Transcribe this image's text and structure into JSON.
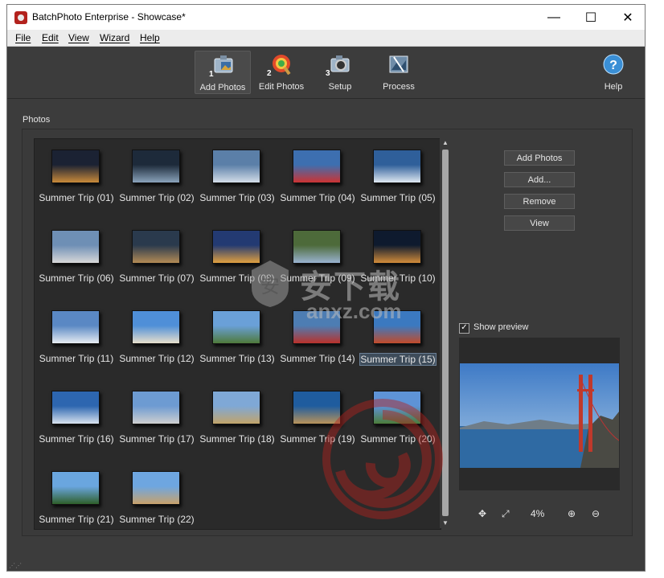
{
  "window": {
    "title": "BatchPhoto Enterprise - Showcase*",
    "minimize": "—",
    "maximize": "☐",
    "close": "✕"
  },
  "menu": [
    "File",
    "Edit",
    "View",
    "Wizard",
    "Help"
  ],
  "toolbar": {
    "steps": [
      {
        "num": "1",
        "label": "Add Photos"
      },
      {
        "num": "2",
        "label": "Edit Photos"
      },
      {
        "num": "3",
        "label": "Setup"
      },
      {
        "num": "",
        "label": "Process"
      }
    ],
    "help": "Help"
  },
  "photos": {
    "section_label": "Photos",
    "items": [
      "Summer Trip (01)",
      "Summer Trip (02)",
      "Summer Trip (03)",
      "Summer Trip (04)",
      "Summer Trip (05)",
      "Summer Trip (06)",
      "Summer Trip (07)",
      "Summer Trip (08)",
      "Summer Trip (09)",
      "Summer Trip (10)",
      "Summer Trip (11)",
      "Summer Trip (12)",
      "Summer Trip (13)",
      "Summer Trip (14)",
      "Summer Trip (15)",
      "Summer Trip (16)",
      "Summer Trip (17)",
      "Summer Trip (18)",
      "Summer Trip (19)",
      "Summer Trip (20)",
      "Summer Trip (21)",
      "Summer Trip (22)"
    ],
    "selected": "Summer Trip (15)"
  },
  "buttons": {
    "add_photos": "Add Photos",
    "add": "Add...",
    "remove": "Remove",
    "view": "View"
  },
  "preview": {
    "show_label": "Show preview",
    "checked": "✓",
    "zoom": "4%"
  },
  "watermark": {
    "text": "安下载",
    "sub": "anxz.com"
  },
  "colors": {
    "window_bg": "#3c3c3c",
    "grid_bg": "#2a2a2a",
    "accent": "#b3221d",
    "selection": "#3e4c5a"
  }
}
